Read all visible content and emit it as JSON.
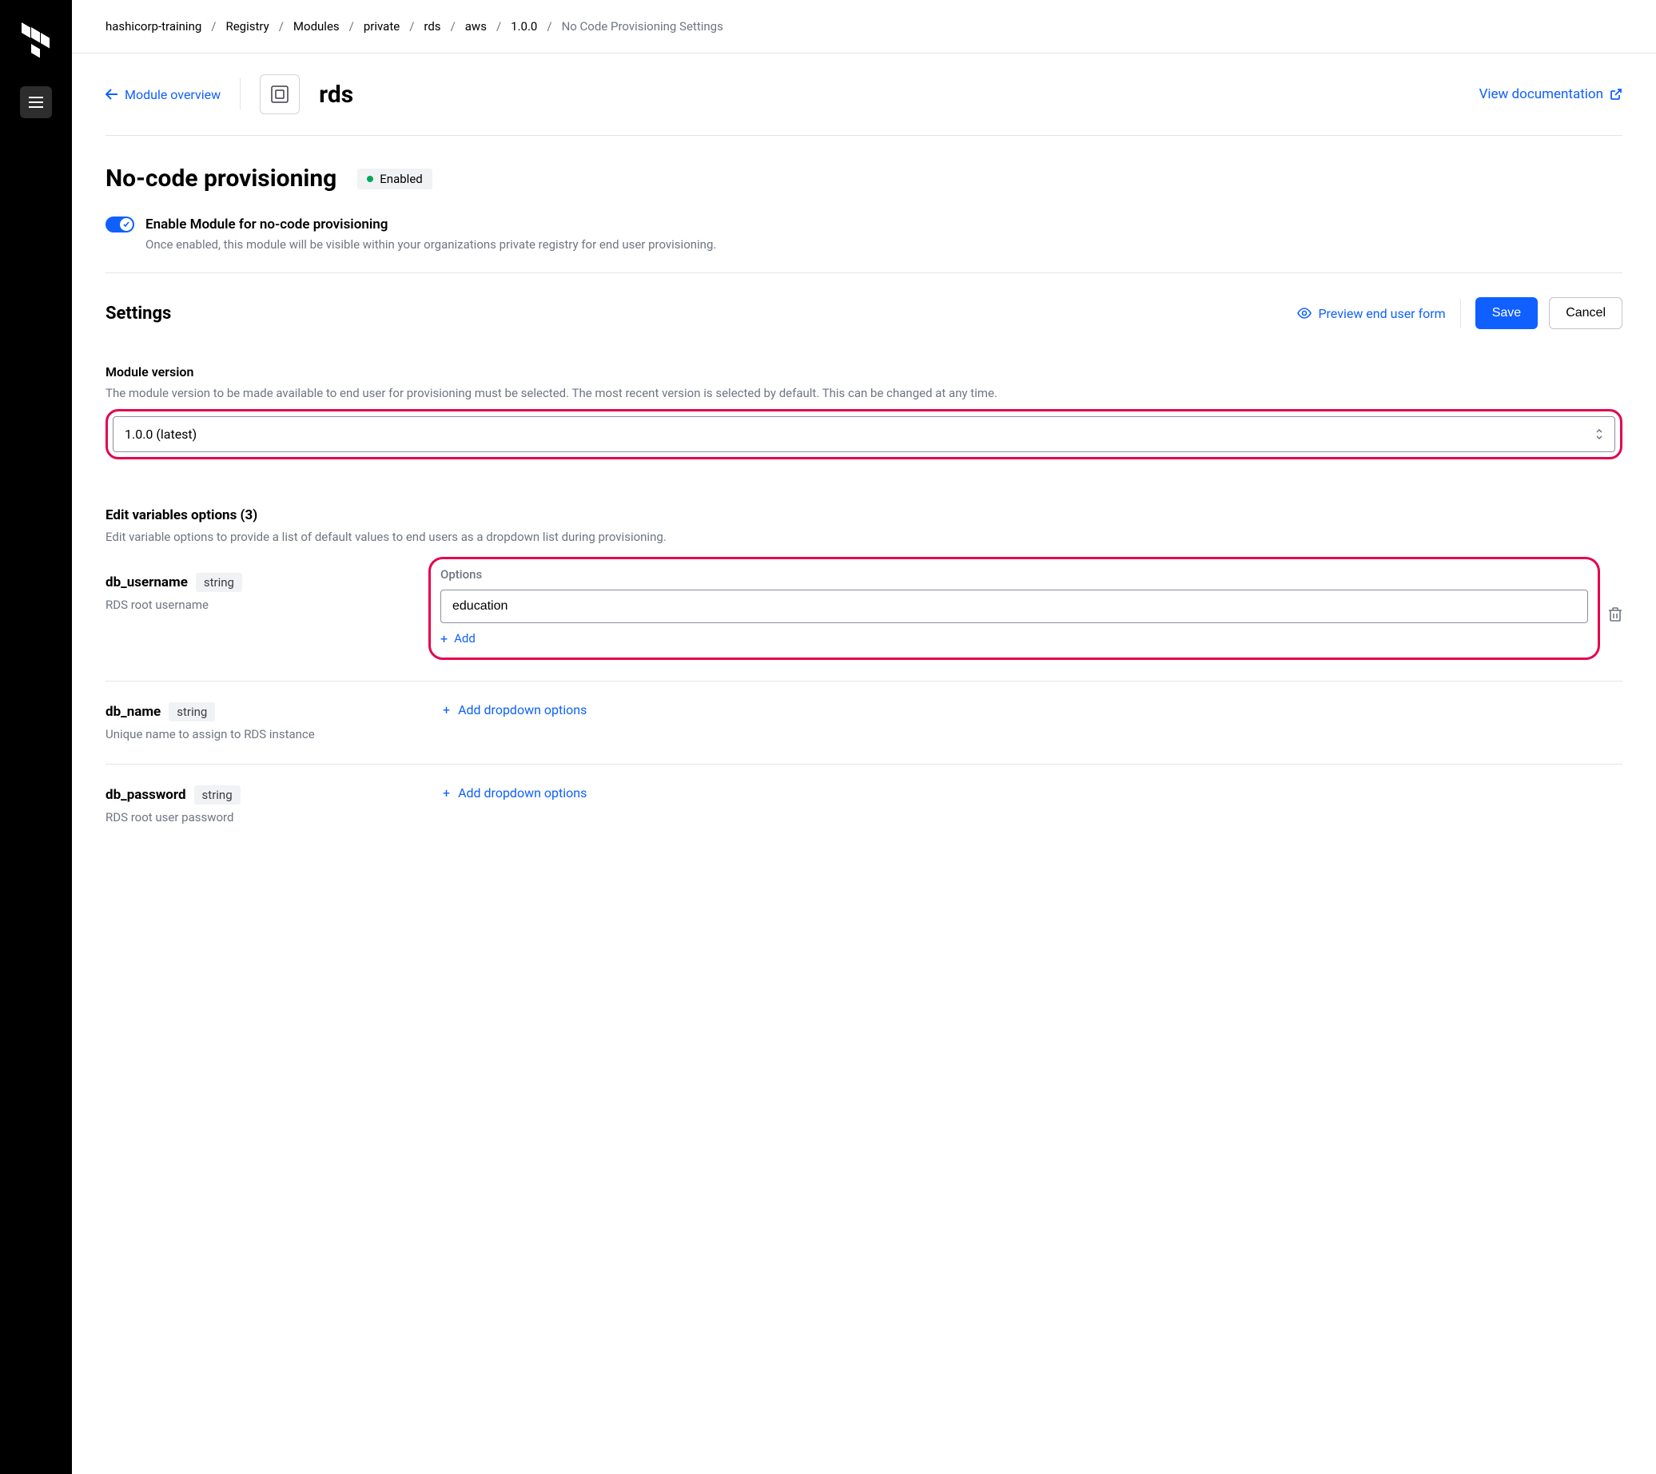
{
  "breadcrumb": {
    "items": [
      "hashicorp-training",
      "Registry",
      "Modules",
      "private",
      "rds",
      "aws",
      "1.0.0"
    ],
    "current": "No Code Provisioning Settings"
  },
  "header": {
    "back_label": "Module overview",
    "module_name": "rds",
    "view_docs_label": "View documentation"
  },
  "page": {
    "title": "No-code provisioning",
    "badge": "Enabled"
  },
  "toggle": {
    "label": "Enable Module for no-code provisioning",
    "desc": "Once enabled, this module will be visible within your organizations private registry for end user provisioning."
  },
  "settings": {
    "title": "Settings",
    "preview_label": "Preview end user form",
    "save_label": "Save",
    "cancel_label": "Cancel"
  },
  "module_version": {
    "label": "Module version",
    "help": "The module version to be made available to end user for provisioning must be selected. The most recent version is selected by default. This can be changed at any time.",
    "value": "1.0.0 (latest)"
  },
  "variables": {
    "label": "Edit variables options (3)",
    "help": "Edit variable options to provide a list of default values to end users as a dropdown list during provisioning.",
    "options_label": "Options",
    "add_label": "Add",
    "add_dd_label": "Add dropdown options",
    "items": [
      {
        "name": "db_username",
        "type": "string",
        "desc": "RDS root username",
        "option_value": "education"
      },
      {
        "name": "db_name",
        "type": "string",
        "desc": "Unique name to assign to RDS instance"
      },
      {
        "name": "db_password",
        "type": "string",
        "desc": "RDS root user password"
      }
    ]
  }
}
